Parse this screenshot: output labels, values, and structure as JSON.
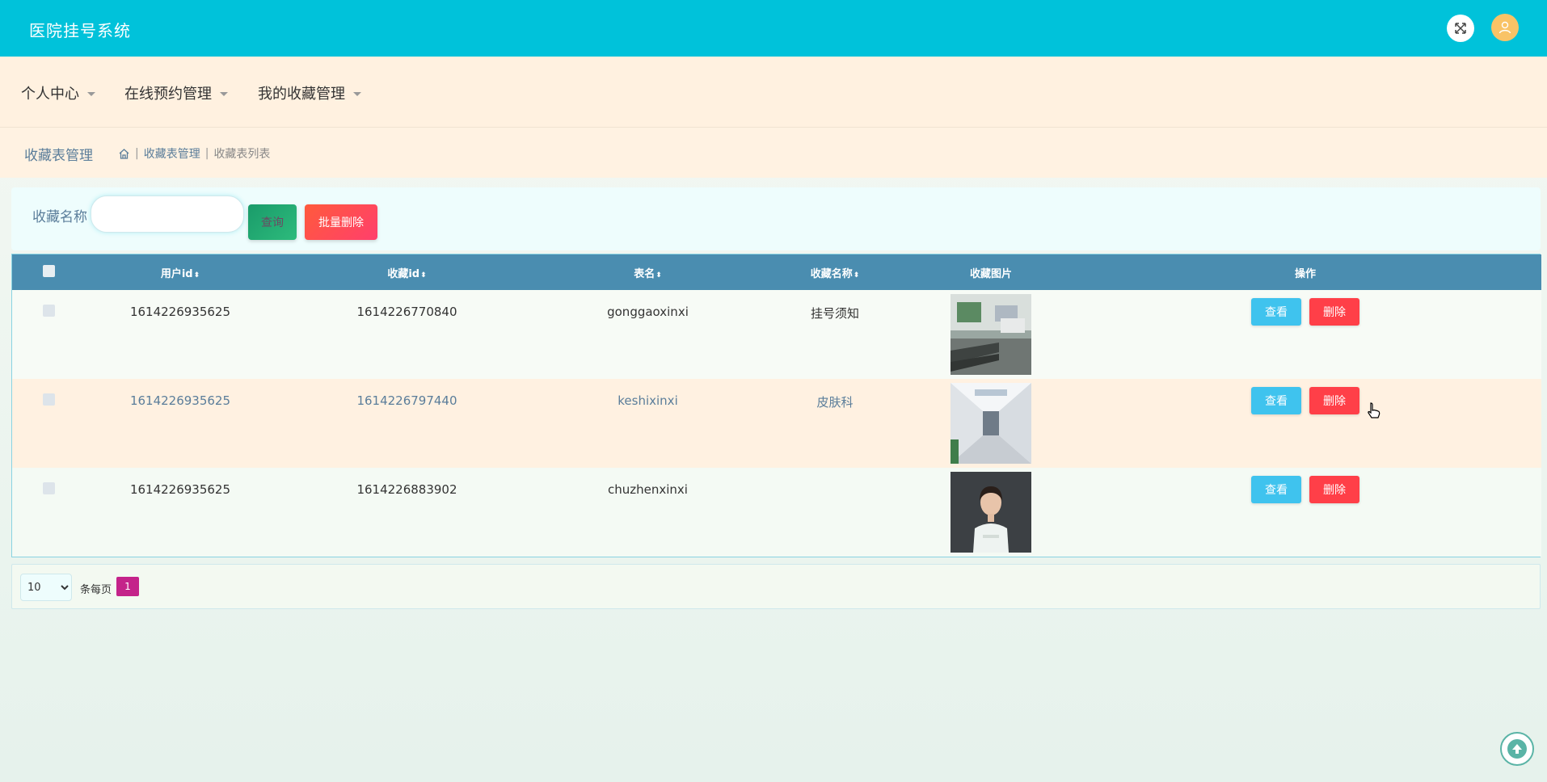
{
  "header": {
    "app_title": "医院挂号系统"
  },
  "nav": {
    "items": [
      {
        "label": "个人中心"
      },
      {
        "label": "在线预约管理"
      },
      {
        "label": "我的收藏管理"
      }
    ]
  },
  "breadcrumb": {
    "section_title": "收藏表管理",
    "crumb_1": "收藏表管理",
    "crumb_2": "收藏表列表"
  },
  "search": {
    "label": "收藏名称",
    "value": "",
    "query_button": "查询",
    "batch_delete_button": "批量删除"
  },
  "table": {
    "headers": {
      "user_id": "用户id",
      "fav_id": "收藏id",
      "table_name": "表名",
      "fav_name": "收藏名称",
      "fav_image": "收藏图片",
      "actions": "操作"
    },
    "rows": [
      {
        "user_id": "1614226935625",
        "fav_id": "1614226770840",
        "table_name": "gonggaoxinxi",
        "fav_name": "挂号须知",
        "image": "hospital-lobby"
      },
      {
        "user_id": "1614226935625",
        "fav_id": "1614226797440",
        "table_name": "keshixinxi",
        "fav_name": "皮肤科",
        "image": "hospital-corridor"
      },
      {
        "user_id": "1614226935625",
        "fav_id": "1614226883902",
        "table_name": "chuzhenxinxi",
        "fav_name": "",
        "image": "doctor-portrait"
      }
    ],
    "view_label": "查看",
    "delete_label": "删除"
  },
  "pagination": {
    "page_size": "10",
    "page_size_options": [
      "10"
    ],
    "per_page_label": "条每页",
    "current_page": "1"
  },
  "colors": {
    "header_bg": "#00c2da",
    "nav_bg": "#fff1e0",
    "table_header_bg": "#4a8db0",
    "view_button": "#3fc3ee",
    "delete_button": "#ff3f48",
    "page_active": "#c4238a"
  }
}
